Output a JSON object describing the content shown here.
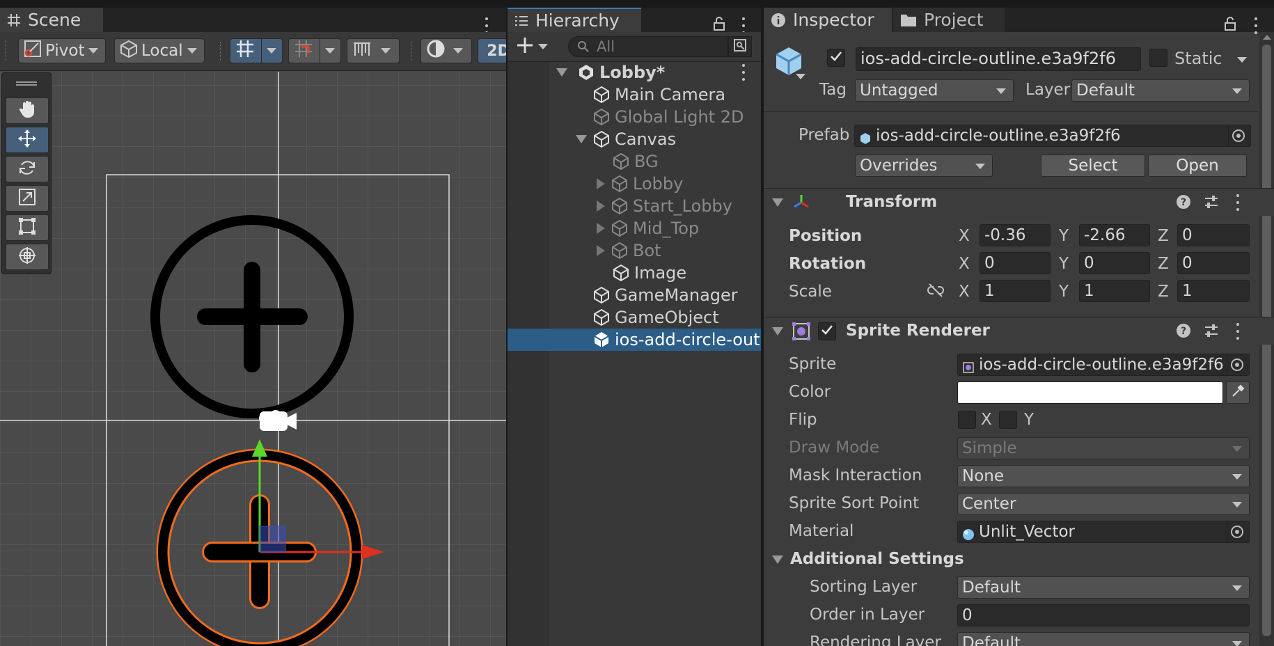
{
  "scene": {
    "tab_label": "Scene",
    "toolbar": {
      "pivot_label": "Pivot",
      "local_label": "Local",
      "mode_2d_label": "2D"
    },
    "tools": [
      "hand-tool",
      "move-tool",
      "rotate-tool",
      "scale-tool",
      "rect-tool",
      "transform-tool"
    ]
  },
  "hierarchy": {
    "tab_label": "Hierarchy",
    "search_placeholder": "All",
    "items": [
      {
        "label": "Lobby*"
      },
      {
        "label": "Main Camera"
      },
      {
        "label": "Global Light 2D"
      },
      {
        "label": "Canvas"
      },
      {
        "label": "BG"
      },
      {
        "label": "Lobby"
      },
      {
        "label": "Start_Lobby"
      },
      {
        "label": "Mid_Top"
      },
      {
        "label": "Bot"
      },
      {
        "label": "Image"
      },
      {
        "label": "GameManager"
      },
      {
        "label": "GameObject"
      },
      {
        "label": "ios-add-circle-out"
      }
    ]
  },
  "inspector": {
    "tab_label": "Inspector",
    "project_tab_label": "Project",
    "object_name": "ios-add-circle-outline.e3a9f2f6",
    "static_label": "Static",
    "tag_label": "Tag",
    "tag_value": "Untagged",
    "layer_label": "Layer",
    "layer_value": "Default",
    "prefab_label": "Prefab",
    "prefab_value": "ios-add-circle-outline.e3a9f2f6",
    "overrides_label": "Overrides",
    "select_label": "Select",
    "open_label": "Open",
    "transform": {
      "title": "Transform",
      "position_label": "Position",
      "rotation_label": "Rotation",
      "scale_label": "Scale",
      "x_label": "X",
      "y_label": "Y",
      "z_label": "Z",
      "position": {
        "x": "-0.36",
        "y": "-2.66",
        "z": "0"
      },
      "rotation": {
        "x": "0",
        "y": "0",
        "z": "0"
      },
      "scale": {
        "x": "1",
        "y": "1",
        "z": "1"
      }
    },
    "sprite_renderer": {
      "title": "Sprite Renderer",
      "sprite_label": "Sprite",
      "sprite_value": "ios-add-circle-outline.e3a9f2f6",
      "color_label": "Color",
      "color_value": "#ffffff",
      "flip_label": "Flip",
      "flip_x_label": "X",
      "flip_y_label": "Y",
      "draw_mode_label": "Draw Mode",
      "draw_mode_value": "Simple",
      "mask_label": "Mask Interaction",
      "mask_value": "None",
      "sort_point_label": "Sprite Sort Point",
      "sort_point_value": "Center",
      "material_label": "Material",
      "material_value": "Unlit_Vector",
      "additional_label": "Additional Settings",
      "sorting_layer_label": "Sorting Layer",
      "sorting_layer_value": "Default",
      "order_label": "Order in Layer",
      "order_value": "0",
      "render_layer_label": "Rendering Layer M",
      "render_layer_value": "Default"
    }
  },
  "colors": {
    "selection": "#2c5d87",
    "outline": "#f26b1d",
    "axis_x": "#e0301e",
    "axis_y": "#5cd62a"
  }
}
